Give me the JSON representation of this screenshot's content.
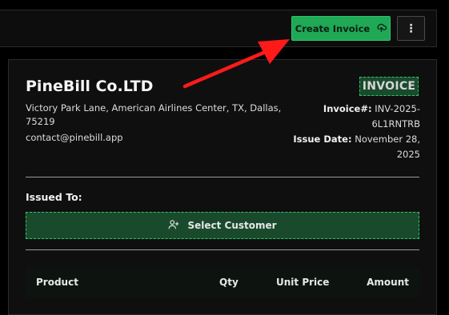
{
  "toolbar": {
    "create_label": "Create Invoice",
    "create_icon": "cloud-upload-icon",
    "more_icon": "more-vertical-icon",
    "more_glyph": "⋮"
  },
  "company": {
    "name": "PineBill Co.LTD",
    "address": "Victory Park Lane, American Airlines Center, TX, Dallas, 75219",
    "email": "contact@pinebill.app"
  },
  "invoice": {
    "badge": "INVOICE",
    "number_label": "Invoice#:",
    "number_value": "INV-2025-6L1RNTRB",
    "date_label": "Issue Date:",
    "date_value": "November 28, 2025"
  },
  "issued_to": {
    "label": "Issued To:",
    "select_label": "Select Customer",
    "select_icon": "user-plus-icon"
  },
  "table": {
    "columns": [
      "Product",
      "Qty",
      "Unit Price",
      "Amount"
    ]
  },
  "colors": {
    "accent": "#1fa855",
    "annotation_arrow": "#ff1a1a"
  }
}
